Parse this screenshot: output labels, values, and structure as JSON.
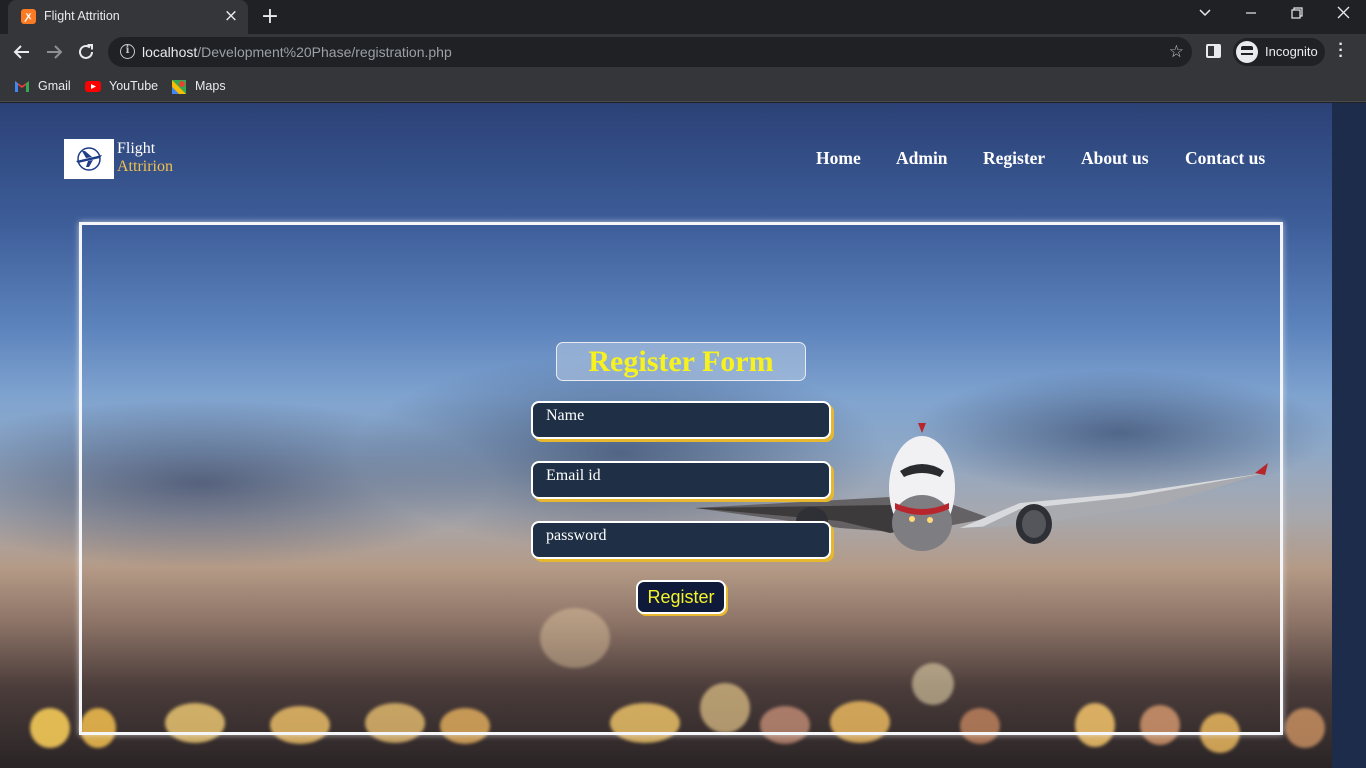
{
  "browser": {
    "tab_title": "Flight Attrition",
    "tab_favicon": "xampp-favicon",
    "new_tab_icon": "+",
    "url_host": "localhost",
    "url_path": "/Development%20Phase/registration.php",
    "profile_label": "Incognito",
    "bookmarks": [
      {
        "label": "Gmail",
        "icon": "gmail-icon"
      },
      {
        "label": "YouTube",
        "icon": "youtube-icon"
      },
      {
        "label": "Maps",
        "icon": "maps-icon"
      }
    ]
  },
  "site": {
    "logo_line1": "Flight",
    "logo_line2": "Attririon",
    "nav": [
      "Home",
      "Admin",
      "Register",
      "About us",
      "Contact us"
    ]
  },
  "form": {
    "title": "Register Form",
    "name_placeholder": "Name",
    "email_placeholder": "Email id",
    "password_placeholder": "password",
    "submit_label": "Register"
  },
  "colors": {
    "title_yellow": "#f7f21d",
    "logo_accent": "#f2c14e",
    "field_bg": "#1f3046",
    "field_shadow": "#e7b82f",
    "button_bg": "#0f1a3a"
  }
}
